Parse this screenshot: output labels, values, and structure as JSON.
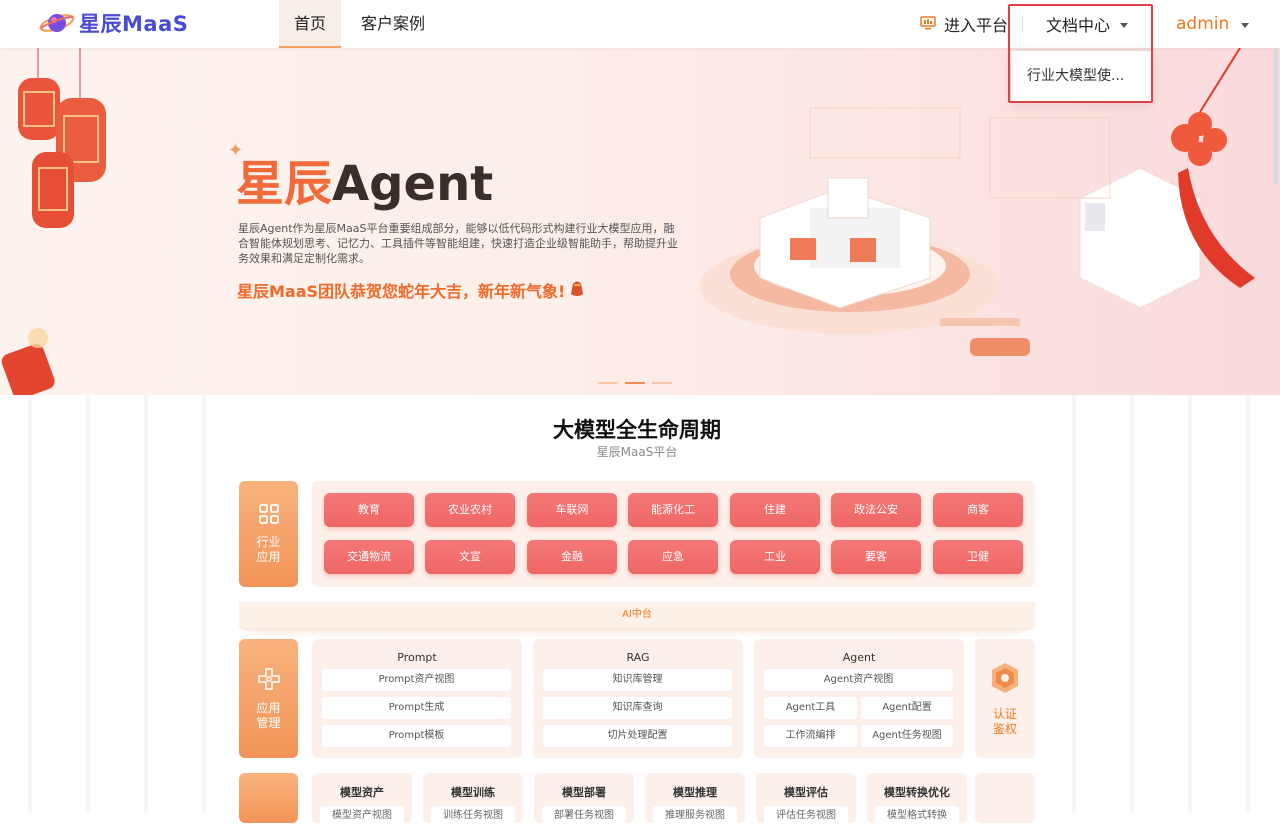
{
  "header": {
    "brand": "星辰MaaS",
    "nav": [
      {
        "label": "首页",
        "active": true
      },
      {
        "label": "客户案例",
        "active": false
      }
    ],
    "enter_platform": "进入平台",
    "docs_center": "文档中心",
    "docs_menu_item": "行业大模型使...",
    "user": "admin"
  },
  "banner": {
    "title_cn": "星辰",
    "title_en": "Agent",
    "description": "星辰Agent作为星辰MaaS平台重要组成部分，能够以低代码形式构建行业大模型应用，融合智能体规划思考、记忆力、工具插件等智能组建，快速打造企业级智能助手，帮助提升业务效果和满足定制化需求。",
    "greeting": "星辰MaaS团队恭贺您蛇年大吉，新年新气象!",
    "slide_count": 3,
    "active_slide": 2
  },
  "lifecycle": {
    "title": "大模型全生命周期",
    "subtitle": "星辰MaaS平台",
    "industry_label": "行业\n应用",
    "industries_row1": [
      "教育",
      "农业农村",
      "车联网",
      "能源化工",
      "住建",
      "政法公安",
      "商客"
    ],
    "industries_row2": [
      "交通物流",
      "文宣",
      "金融",
      "应急",
      "工业",
      "要客",
      "卫健"
    ],
    "ai_platform": "AI中台",
    "app_mgmt_label": "应用\n管理",
    "prompt": {
      "title": "Prompt",
      "items": [
        "Prompt资产视图",
        "Prompt生成",
        "Prompt模板"
      ]
    },
    "rag": {
      "title": "RAG",
      "items": [
        "知识库管理",
        "知识库查询",
        "切片处理配置"
      ]
    },
    "agent": {
      "title": "Agent",
      "items": [
        "Agent资产视图",
        "Agent工具",
        "Agent配置",
        "工作流编排",
        "Agent任务视图"
      ]
    },
    "auth_label": "认证\n鉴权",
    "model_modules": [
      {
        "title": "模型资产",
        "sub": "模型资产视图"
      },
      {
        "title": "模型训练",
        "sub": "训练任务视图"
      },
      {
        "title": "模型部署",
        "sub": "部署任务视图"
      },
      {
        "title": "模型推理",
        "sub": "推理服务视图"
      },
      {
        "title": "模型评估",
        "sub": "评估任务视图"
      },
      {
        "title": "模型转换优化",
        "sub": "模型格式转换"
      }
    ]
  },
  "colors": {
    "accent": "#f07a20",
    "brand": "#4b4ad6",
    "industry_button": "#f06e6d",
    "highlight_frame": "#e0404a"
  },
  "icons": [
    "logo-planet-icon",
    "monitor-icon",
    "chevron-down-icon",
    "sparkle-icon",
    "lucky-bag-icon",
    "grid-icon",
    "app-mgmt-icon",
    "auth-shield-icon"
  ]
}
